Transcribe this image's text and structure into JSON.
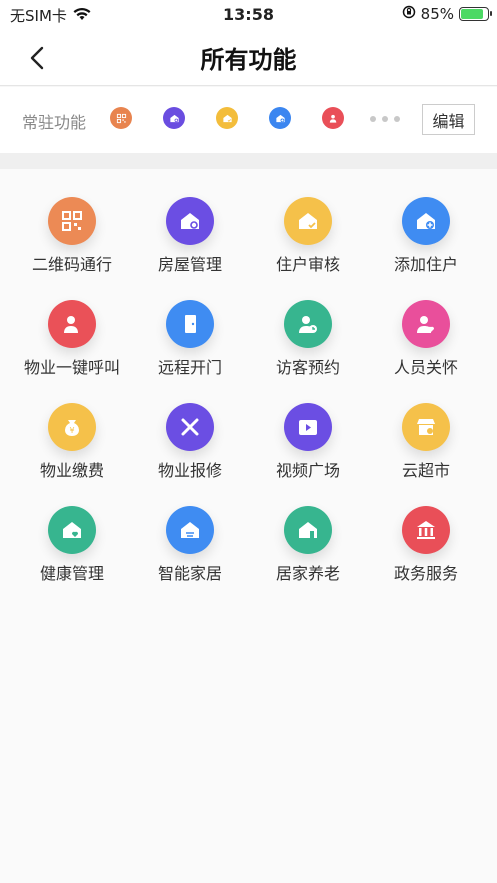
{
  "status": {
    "carrier": "无SIM卡",
    "time": "13:58",
    "battery": "85%"
  },
  "nav": {
    "title": "所有功能"
  },
  "fixed": {
    "label": "常驻功能",
    "edit": "编辑",
    "icons": [
      {
        "name": "qr-code-icon",
        "color": "#e8844f"
      },
      {
        "name": "house-gear-icon",
        "color": "#6a4de0"
      },
      {
        "name": "house-check-icon",
        "color": "#f3bd3b"
      },
      {
        "name": "house-plus-icon",
        "color": "#3b86f0"
      },
      {
        "name": "phone-person-icon",
        "color": "#e94f58"
      }
    ]
  },
  "features": [
    {
      "label": "二维码通行",
      "icon": "qr-code-icon",
      "color": "#ec8a55"
    },
    {
      "label": "房屋管理",
      "icon": "house-gear-icon",
      "color": "#6b4ee3"
    },
    {
      "label": "住户审核",
      "icon": "house-check-icon",
      "color": "#f5c14a"
    },
    {
      "label": "添加住户",
      "icon": "house-plus-icon",
      "color": "#3f8cf2"
    },
    {
      "label": "物业一键呼叫",
      "icon": "phone-person-icon",
      "color": "#ea5158"
    },
    {
      "label": "远程开门",
      "icon": "door-icon",
      "color": "#3f8cf2"
    },
    {
      "label": "访客预约",
      "icon": "visitor-clock-icon",
      "color": "#37b58f"
    },
    {
      "label": "人员关怀",
      "icon": "person-heart-icon",
      "color": "#e94f9b"
    },
    {
      "label": "物业缴费",
      "icon": "money-bag-icon",
      "color": "#f5c14a"
    },
    {
      "label": "物业报修",
      "icon": "tools-icon",
      "color": "#6b4ee3"
    },
    {
      "label": "视频广场",
      "icon": "video-icon",
      "color": "#6b4ee3"
    },
    {
      "label": "云超市",
      "icon": "store-icon",
      "color": "#f5c14a"
    },
    {
      "label": "健康管理",
      "icon": "health-home-icon",
      "color": "#37b58f"
    },
    {
      "label": "智能家居",
      "icon": "smart-home-icon",
      "color": "#3f8cf2"
    },
    {
      "label": "居家养老",
      "icon": "elder-home-icon",
      "color": "#37b58f"
    },
    {
      "label": "政务服务",
      "icon": "government-icon",
      "color": "#e94f58"
    }
  ]
}
